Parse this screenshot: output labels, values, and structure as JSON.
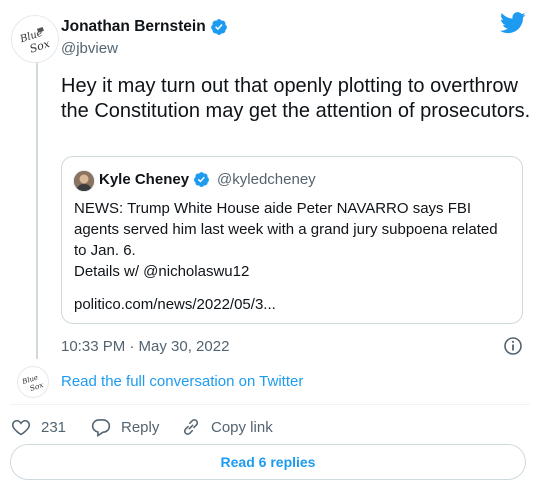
{
  "tweet": {
    "author_name": "Jonathan Bernstein",
    "author_handle": "@jbview",
    "avatar_text_1": "Blue",
    "avatar_text_2": "Sox",
    "text": "Hey it may turn out that openly plotting to overthrow the Constitution may get the attention of prosecutors.",
    "timestamp": "10:33 PM · May 30, 2022"
  },
  "quote": {
    "author_name": "Kyle Cheney",
    "author_handle": "@kyledcheney",
    "line1": "NEWS: Trump White House aide Peter NAVARRO says FBI agents served him last week with a grand jury subpoena related to Jan. 6.",
    "line2": "Details w/ @nicholaswu12",
    "line3": "politico.com/news/2022/05/3..."
  },
  "conversation": {
    "link_text": "Read the full conversation on Twitter"
  },
  "actions": {
    "like_count": "231",
    "reply_label": "Reply",
    "copy_label": "Copy link"
  },
  "read_replies": "Read 6 replies",
  "colors": {
    "accent": "#1d9bf0",
    "muted": "#536471",
    "border": "#cfd9de"
  },
  "icons": [
    "twitter-bird-icon",
    "verified-badge-icon",
    "info-icon",
    "heart-icon",
    "reply-icon",
    "link-icon"
  ]
}
